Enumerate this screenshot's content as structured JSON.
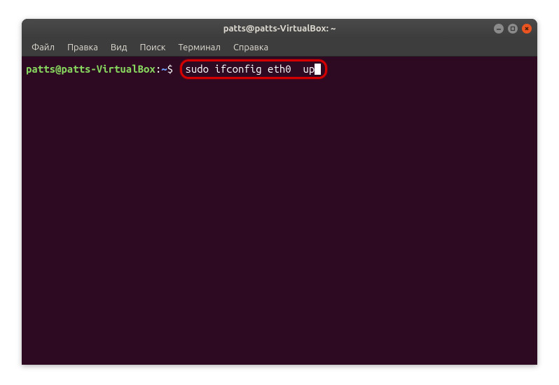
{
  "window": {
    "title": "patts@patts-VirtualBox: ~"
  },
  "menubar": {
    "items": [
      {
        "label": "Файл"
      },
      {
        "label": "Правка"
      },
      {
        "label": "Вид"
      },
      {
        "label": "Поиск"
      },
      {
        "label": "Терминал"
      },
      {
        "label": "Справка"
      }
    ]
  },
  "prompt": {
    "user_host": "patts@patts-VirtualBox",
    "separator": ":",
    "path": "~",
    "dollar": "$ "
  },
  "command": "sudo ifconfig eth0  up",
  "window_controls": {
    "minimize": "−",
    "maximize": "□",
    "close": "×"
  }
}
